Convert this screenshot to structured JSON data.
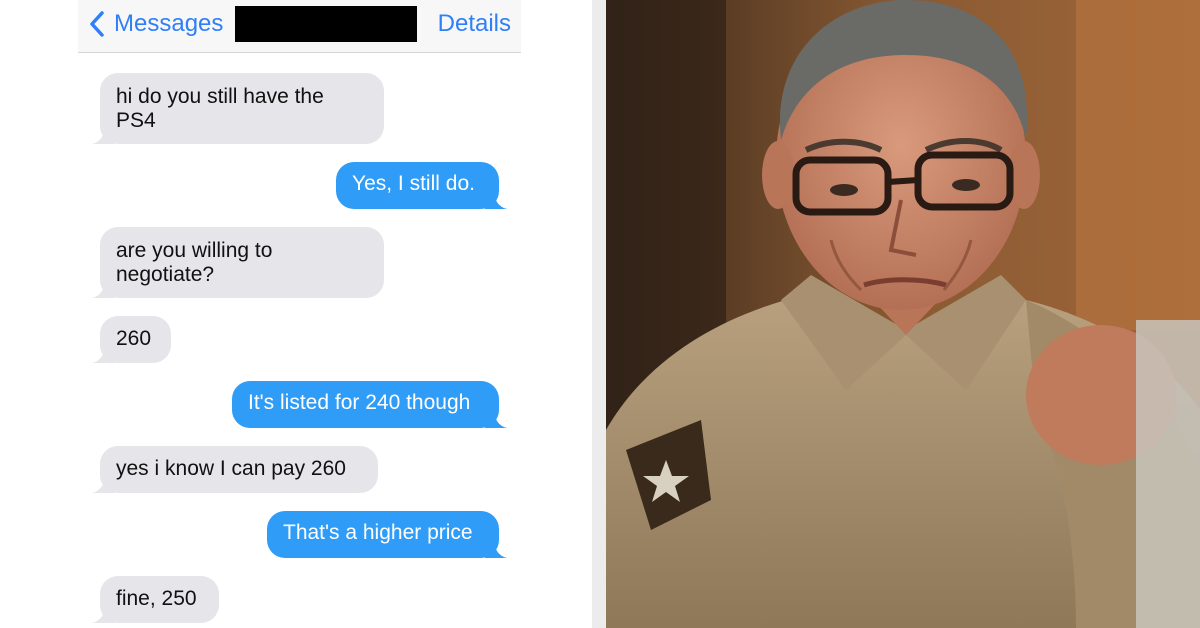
{
  "header": {
    "back_label": "Messages",
    "details_label": "Details"
  },
  "messages": [
    {
      "from": "them",
      "text": "hi do you still have the\nPS4"
    },
    {
      "from": "me",
      "text": "Yes, I still do."
    },
    {
      "from": "them",
      "text": "are you willing to\nnegotiate?"
    },
    {
      "from": "them",
      "text": "260"
    },
    {
      "from": "me",
      "text": "It's listed for 240 though"
    },
    {
      "from": "them",
      "text": "yes i know I can pay 260"
    },
    {
      "from": "me",
      "text": "That's a higher price"
    },
    {
      "from": "them",
      "text": "fine, 250"
    }
  ],
  "colors": {
    "accent": "#2f7ff6",
    "incoming_bubble": "#e5e5ea",
    "outgoing_bubble": "#2f9cf7"
  },
  "icons": {
    "back": "chevron-left-icon"
  }
}
